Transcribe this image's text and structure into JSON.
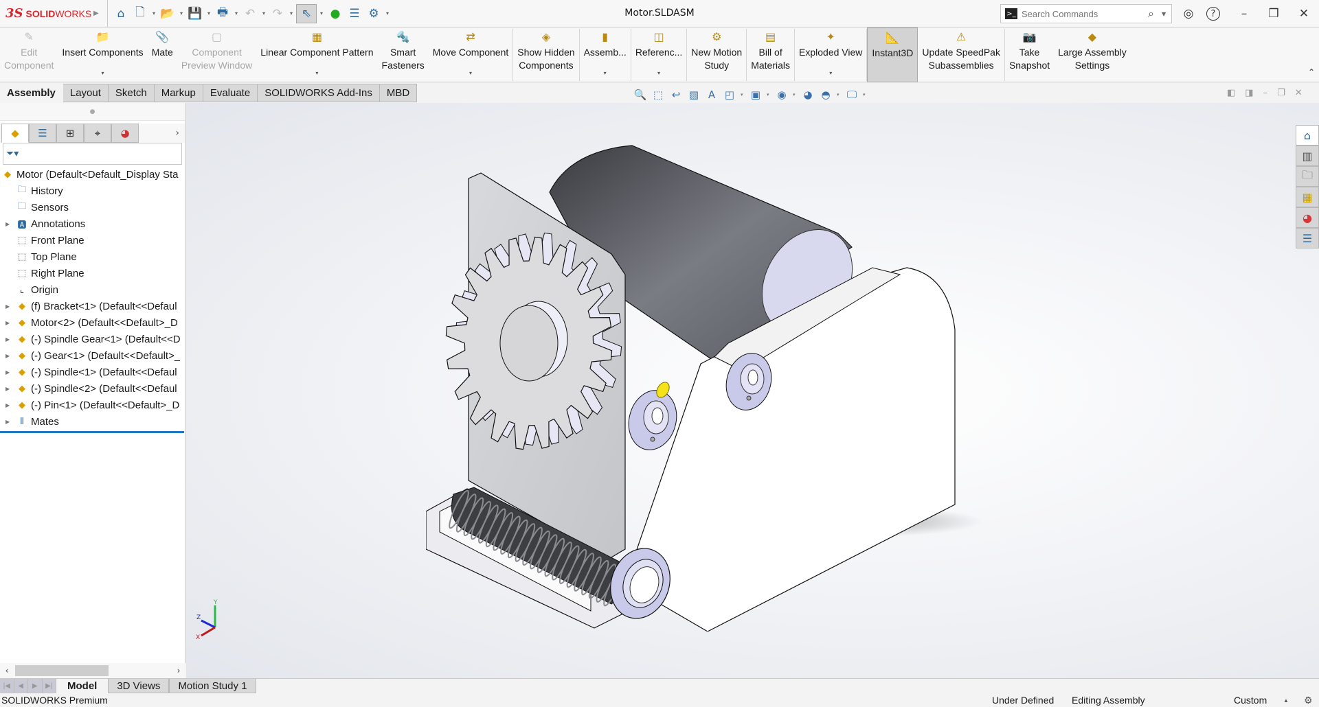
{
  "app": {
    "brand_ds": "3S",
    "brand_solid": "SOLID",
    "brand_works": "WORKS",
    "document_title": "Motor.SLDASM"
  },
  "quick_access": [
    {
      "name": "home",
      "icon": "⌂"
    },
    {
      "name": "new-document",
      "icon": "🗋"
    },
    {
      "name": "open",
      "icon": "📂"
    },
    {
      "name": "save",
      "icon": "💾"
    },
    {
      "name": "print",
      "icon": "🖶"
    },
    {
      "name": "undo",
      "icon": "↶"
    },
    {
      "name": "redo",
      "icon": "↷"
    },
    {
      "name": "select",
      "icon": "⇖"
    },
    {
      "name": "rebuild",
      "icon": "●"
    },
    {
      "name": "file-properties",
      "icon": "☰"
    },
    {
      "name": "options",
      "icon": "⚙"
    }
  ],
  "search": {
    "placeholder": "Search Commands",
    "value": ""
  },
  "window_controls": {
    "user": "◎",
    "help": "?",
    "minimize": "–",
    "restore": "❐",
    "close": "✕"
  },
  "ribbon": {
    "buttons": [
      {
        "id": "edit-component",
        "label1": "Edit",
        "label2": "Component",
        "icon": "✎",
        "disabled": true
      },
      {
        "id": "insert-components",
        "label1": "Insert Components",
        "label2": "",
        "icon": "📁",
        "dropdown": true
      },
      {
        "id": "mate",
        "label1": "Mate",
        "label2": "",
        "icon": "📎"
      },
      {
        "id": "component-preview-window",
        "label1": "Component",
        "label2": "Preview Window",
        "icon": "▢",
        "disabled": true
      },
      {
        "id": "linear-component-pattern",
        "label1": "Linear Component Pattern",
        "label2": "",
        "icon": "▦",
        "dropdown": true
      },
      {
        "id": "smart-fasteners",
        "label1": "Smart",
        "label2": "Fasteners",
        "icon": "🔩"
      },
      {
        "id": "move-component",
        "label1": "Move Component",
        "label2": "",
        "icon": "⇄",
        "dropdown": true
      },
      {
        "id": "show-hidden-components",
        "label1": "Show Hidden",
        "label2": "Components",
        "icon": "◈"
      },
      {
        "id": "assembly-features",
        "label1": "Assemb...",
        "label2": "",
        "icon": "▮",
        "dropdown": true
      },
      {
        "id": "reference-geometry",
        "label1": "Referenc...",
        "label2": "",
        "icon": "◫",
        "dropdown": true
      },
      {
        "id": "new-motion-study",
        "label1": "New Motion",
        "label2": "Study",
        "icon": "⚙"
      },
      {
        "id": "bill-of-materials",
        "label1": "Bill of",
        "label2": "Materials",
        "icon": "▤"
      },
      {
        "id": "exploded-view",
        "label1": "Exploded View",
        "label2": "",
        "icon": "✦",
        "dropdown": true
      },
      {
        "id": "instant3d",
        "label1": "Instant3D",
        "label2": "",
        "icon": "📐",
        "active": true
      },
      {
        "id": "update-speedpak",
        "label1": "Update SpeedPak",
        "label2": "Subassemblies",
        "icon": "⚠"
      },
      {
        "id": "take-snapshot",
        "label1": "Take",
        "label2": "Snapshot",
        "icon": "📷"
      },
      {
        "id": "large-assembly-settings",
        "label1": "Large Assembly",
        "label2": "Settings",
        "icon": "◆"
      }
    ],
    "collapse_icon": "⌃"
  },
  "command_tabs": [
    {
      "label": "Assembly",
      "active": true
    },
    {
      "label": "Layout"
    },
    {
      "label": "Sketch"
    },
    {
      "label": "Markup"
    },
    {
      "label": "Evaluate"
    },
    {
      "label": "SOLIDWORKS Add-Ins"
    },
    {
      "label": "MBD"
    }
  ],
  "manager_tabs": [
    {
      "name": "featuremanager",
      "icon": "◆",
      "active": true
    },
    {
      "name": "propertymanager",
      "icon": "☰"
    },
    {
      "name": "configurationmanager",
      "icon": "⊞"
    },
    {
      "name": "dimxpertmanager",
      "icon": "⌖"
    },
    {
      "name": "displaymanager",
      "icon": "◕"
    }
  ],
  "feature_tree": {
    "filter_icon": "⏷",
    "root": {
      "label": "Motor  (Default<Default_Display Sta",
      "icon": "assembly"
    },
    "items": [
      {
        "label": "History",
        "icon": "history-folder",
        "expandable": false
      },
      {
        "label": "Sensors",
        "icon": "sensors-folder",
        "expandable": false
      },
      {
        "label": "Annotations",
        "icon": "annotations-folder",
        "expandable": true
      },
      {
        "label": "Front Plane",
        "icon": "plane",
        "expandable": false
      },
      {
        "label": "Top Plane",
        "icon": "plane",
        "expandable": false
      },
      {
        "label": "Right Plane",
        "icon": "plane",
        "expandable": false
      },
      {
        "label": "Origin",
        "icon": "origin",
        "expandable": false
      },
      {
        "label": "(f) Bracket<1> (Default<<Defaul",
        "icon": "part",
        "expandable": true
      },
      {
        "label": "Motor<2> (Default<<Default>_D",
        "icon": "part",
        "expandable": true
      },
      {
        "label": "(-) Spindle Gear<1> (Default<<D",
        "icon": "part",
        "expandable": true
      },
      {
        "label": "(-) Gear<1> (Default<<Default>_",
        "icon": "part",
        "expandable": true
      },
      {
        "label": "(-) Spindle<1> (Default<<Defaul",
        "icon": "part",
        "expandable": true
      },
      {
        "label": "(-) Spindle<2> (Default<<Defaul",
        "icon": "part",
        "expandable": true
      },
      {
        "label": "(-) Pin<1> (Default<<Default>_D",
        "icon": "part",
        "expandable": true
      },
      {
        "label": "Mates",
        "icon": "mates",
        "expandable": true
      }
    ]
  },
  "heads_up_toolbar": [
    {
      "name": "zoom-to-fit",
      "icon": "🔍"
    },
    {
      "name": "zoom-to-area",
      "icon": "⬚"
    },
    {
      "name": "previous-view",
      "icon": "↩"
    },
    {
      "name": "section-view",
      "icon": "▧"
    },
    {
      "name": "dynamic-annotation-views",
      "icon": "A"
    },
    {
      "name": "view-orientation",
      "icon": "◰",
      "dropdown": true
    },
    {
      "name": "display-style",
      "icon": "▣",
      "dropdown": true
    },
    {
      "name": "hide-show-items",
      "icon": "◉",
      "dropdown": true
    },
    {
      "name": "edit-appearance",
      "icon": "◕"
    },
    {
      "name": "apply-scene",
      "icon": "◓",
      "dropdown": true
    },
    {
      "name": "view-settings",
      "icon": "🖵",
      "dropdown": true
    }
  ],
  "viewport_controls": [
    "◧",
    "◨",
    "–",
    "❐",
    "✕"
  ],
  "task_pane": [
    {
      "name": "solidworks-resources",
      "icon": "⌂",
      "active": true
    },
    {
      "name": "design-library",
      "icon": "▥"
    },
    {
      "name": "file-explorer",
      "icon": "🗀"
    },
    {
      "name": "view-palette",
      "icon": "▦"
    },
    {
      "name": "appearances-scenes",
      "icon": "◕"
    },
    {
      "name": "custom-properties",
      "icon": "☰"
    }
  ],
  "triad": {
    "x": "X",
    "y": "Y",
    "z": "Z"
  },
  "bottom_tabs": [
    {
      "label": "Model",
      "active": true
    },
    {
      "label": "3D Views"
    },
    {
      "label": "Motion Study 1"
    }
  ],
  "status": {
    "product": "SOLIDWORKS Premium",
    "definition": "Under Defined",
    "mode": "Editing Assembly",
    "units": "Custom"
  },
  "colors": {
    "brand_red": "#d7262b",
    "selection_blue": "#1c78c0",
    "motor_body": "#6b6d74",
    "bracket": "#ffffff",
    "plate": "#cfd0d4",
    "bearing": "#c9c9ea",
    "pin_yellow": "#f5e21a"
  }
}
